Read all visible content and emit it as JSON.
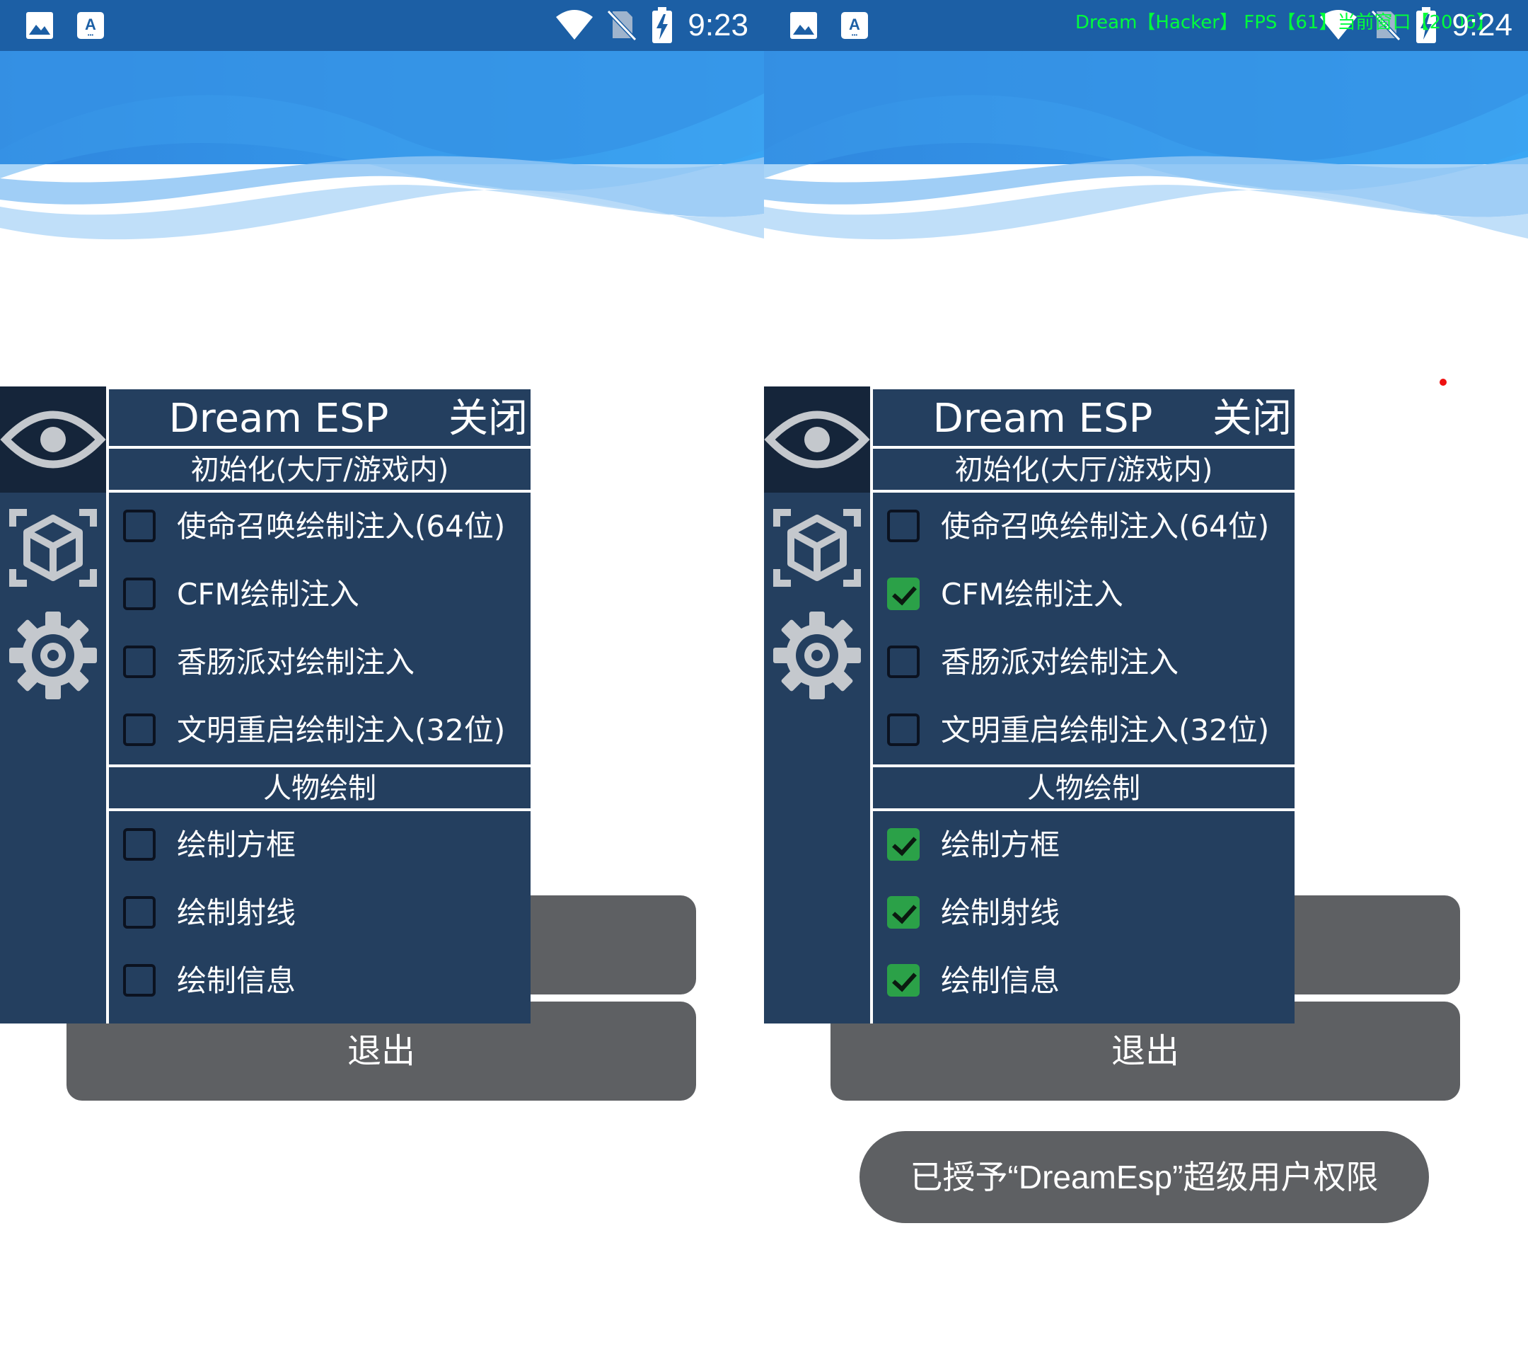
{
  "colors": {
    "status_bar": "#1c5fa5",
    "panel": "#243f5f",
    "sidebar_active": "#15253a",
    "checked": "#2ba148",
    "button": "#5e6063",
    "overlay_text": "#00ff3c"
  },
  "status_bar_icons": [
    "image-icon",
    "keyboard-a-icon",
    "wifi-icon",
    "no-sim-icon",
    "battery-charging-icon"
  ],
  "sidebar_icons": [
    "eye-icon",
    "cube-icon",
    "gear-icon"
  ],
  "screens": [
    {
      "time": "9:23",
      "overlay": "",
      "panel": {
        "title": "Dream ESP",
        "close_label": "关闭",
        "sections": [
          {
            "header": "初始化(大厅/游戏内)",
            "items": [
              {
                "label": "使命召唤绘制注入(64位)",
                "checked": false
              },
              {
                "label": "CFM绘制注入",
                "checked": false
              },
              {
                "label": "香肠派对绘制注入",
                "checked": false
              },
              {
                "label": "文明重启绘制注入(32位)",
                "checked": false
              }
            ]
          },
          {
            "header": "人物绘制",
            "items": [
              {
                "label": "绘制方框",
                "checked": false
              },
              {
                "label": "绘制射线",
                "checked": false
              },
              {
                "label": "绘制信息",
                "checked": false
              }
            ]
          }
        ]
      },
      "exit_label": "退出",
      "toast": ""
    },
    {
      "time": "9:24",
      "overlay": "Dream【Hacker】 FPS【61】当前窗口【2006】",
      "panel": {
        "title": "Dream ESP",
        "close_label": "关闭",
        "sections": [
          {
            "header": "初始化(大厅/游戏内)",
            "items": [
              {
                "label": "使命召唤绘制注入(64位)",
                "checked": false
              },
              {
                "label": "CFM绘制注入",
                "checked": true
              },
              {
                "label": "香肠派对绘制注入",
                "checked": false
              },
              {
                "label": "文明重启绘制注入(32位)",
                "checked": false
              }
            ]
          },
          {
            "header": "人物绘制",
            "items": [
              {
                "label": "绘制方框",
                "checked": true
              },
              {
                "label": "绘制射线",
                "checked": true
              },
              {
                "label": "绘制信息",
                "checked": true
              }
            ]
          }
        ]
      },
      "exit_label": "退出",
      "toast": "已授予“DreamEsp”超级用户权限"
    }
  ]
}
